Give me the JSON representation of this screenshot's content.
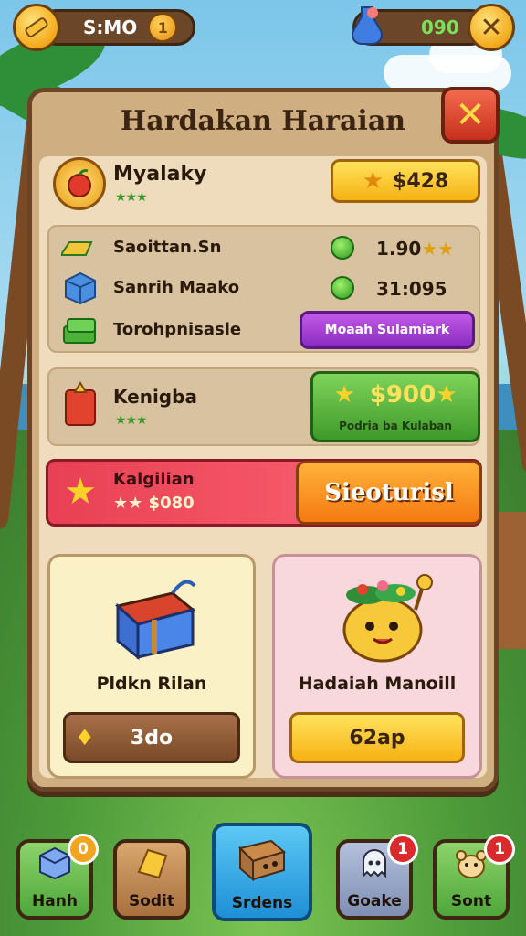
{
  "hud": {
    "left_value": "S:MO",
    "left_coin": "1",
    "right_value": "090",
    "left_icon": "gold-bar-icon",
    "right_icon": "potion-icon"
  },
  "panel": {
    "title": "Hardakan Haraian",
    "close_label": "✕",
    "profile": {
      "name": "Myalaky",
      "stars": "★★★",
      "price": "$428",
      "icon": "apple-medal-icon"
    },
    "list": [
      {
        "label": "Saoittan.Sn",
        "value": "1.90",
        "value_stars": "★★",
        "icon": "gold-bar-icon"
      },
      {
        "label": "Sanrih Maako",
        "value": "31:095",
        "icon": "blue-cube-icon"
      },
      {
        "label": "Torohpnisasle",
        "action": "Moaah Sulamiark",
        "icon": "cash-stack-icon"
      }
    ],
    "offer": {
      "name": "Kenigba",
      "stars": "★★★",
      "price": "$900",
      "price_sub": "Podria ba Kulaban",
      "icon": "gift-card-icon"
    },
    "special": {
      "name": "Kalgilian",
      "sub": "★★ $080",
      "button": "Sieoturisl",
      "icon": "star-icon"
    },
    "cards": [
      {
        "title": "Pldkn Rilan",
        "button": "3do",
        "icon": "treasure-chest-icon",
        "button_icon": "crystal-icon"
      },
      {
        "title": "Hadaiah Manoill",
        "button": "62ap",
        "icon": "flower-creature-icon"
      }
    ]
  },
  "nav": [
    {
      "label": "Hanh",
      "badge": "0",
      "badge_color": "gold",
      "icon": "cube-icon"
    },
    {
      "label": "Sodit",
      "icon": "ticket-icon"
    },
    {
      "label": "Srdens",
      "icon": "box-icon"
    },
    {
      "label": "Goake",
      "badge": "1",
      "badge_color": "red",
      "icon": "ghost-icon"
    },
    {
      "label": "Sont",
      "badge": "1",
      "badge_color": "red",
      "icon": "pet-icon"
    }
  ]
}
